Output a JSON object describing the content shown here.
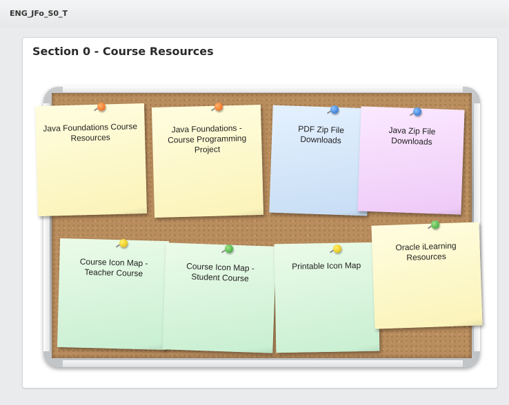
{
  "header": {
    "code": "ENG_JFo_S0_T"
  },
  "section": {
    "title": "Section 0 - Course Resources"
  },
  "notes": [
    {
      "label": "Java Foundations Course Resources",
      "color": "yellow",
      "pin": "orange"
    },
    {
      "label": "Java Foundations - Course Programming Project",
      "color": "yellow",
      "pin": "orange"
    },
    {
      "label": "PDF Zip File Downloads",
      "color": "blue",
      "pin": "blue"
    },
    {
      "label": "Java Zip File Downloads",
      "color": "pink",
      "pin": "blue"
    },
    {
      "label": "Course Icon Map - Teacher Course",
      "color": "green",
      "pin": "yellow"
    },
    {
      "label": "Course Icon Map - Student Course",
      "color": "green",
      "pin": "green"
    },
    {
      "label": "Printable Icon Map",
      "color": "green",
      "pin": "yellow"
    },
    {
      "label": "Oracle iLearning Resources",
      "color": "yellow",
      "pin": "green"
    }
  ]
}
